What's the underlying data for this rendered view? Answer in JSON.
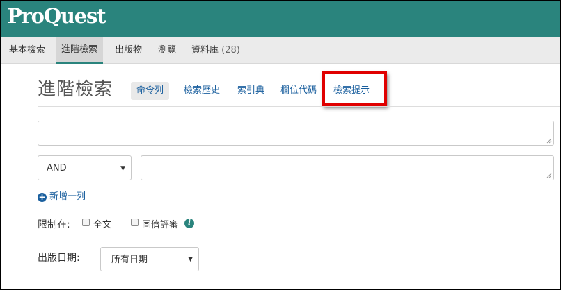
{
  "header": {
    "logo": "ProQuest",
    "background_color": "#2a847d"
  },
  "nav": {
    "items": [
      {
        "label": "基本檢索",
        "active": false
      },
      {
        "label": "進階檢索",
        "active": true
      },
      {
        "label": "出版物",
        "active": false
      },
      {
        "label": "瀏覽",
        "active": false
      },
      {
        "label": "資料庫",
        "count": "(28)",
        "active": false
      }
    ]
  },
  "main": {
    "title": "進階檢索",
    "tabs": [
      {
        "label": "命令列",
        "selected": true
      },
      {
        "label": "檢索歷史",
        "selected": false
      },
      {
        "label": "索引典",
        "selected": false
      },
      {
        "label": "欄位代碼",
        "selected": false
      },
      {
        "label": "檢索提示",
        "selected": false,
        "highlighted": true
      }
    ],
    "highlight_color": "#e00000",
    "search_rows": [
      {
        "operator": null,
        "value": ""
      },
      {
        "operator": "AND",
        "value": ""
      }
    ],
    "add_row_label": "新增一列",
    "limit": {
      "label": "限制在:",
      "options": [
        {
          "label": "全文",
          "checked": false
        },
        {
          "label": "同儕評審",
          "checked": false
        }
      ],
      "info_icon": "info-icon"
    },
    "pub_date": {
      "label": "出版日期:",
      "selected": "所有日期"
    }
  }
}
